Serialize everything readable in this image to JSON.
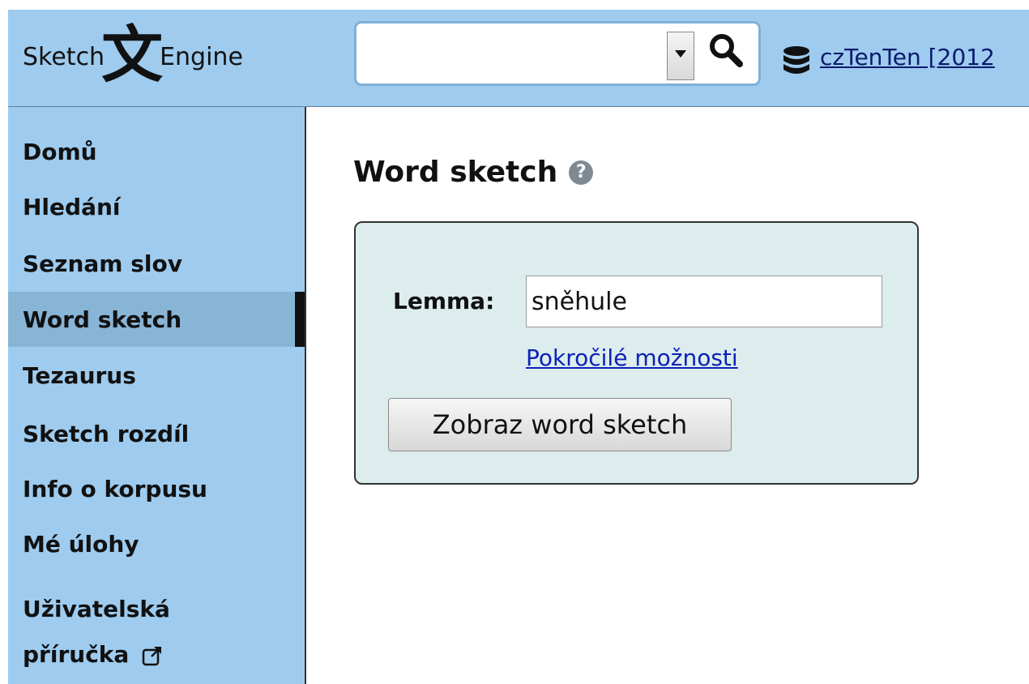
{
  "header": {
    "logo_left": "Sketch",
    "logo_glyph": "文",
    "logo_right": "Engine",
    "search": {
      "value": "",
      "placeholder": ""
    },
    "corpus_link": "czTenTen [2012"
  },
  "sidebar": {
    "items": [
      {
        "label": "Domů"
      },
      {
        "label": "Hledání"
      },
      {
        "label": "Seznam slov"
      },
      {
        "label": "Word sketch",
        "active": true
      },
      {
        "label": "Tezaurus"
      },
      {
        "label": "Sketch rozdíl"
      },
      {
        "label": "Info o korpusu"
      },
      {
        "label": "Mé úlohy"
      }
    ],
    "manual": {
      "line1": "Uživatelská",
      "line2": "příručka"
    }
  },
  "main": {
    "title": "Word sketch",
    "help_glyph": "?",
    "form": {
      "lemma_label": "Lemma:",
      "lemma_value": "sněhule",
      "advanced_link": "Pokročilé možnosti",
      "submit_label": "Zobraz word sketch"
    }
  },
  "colors": {
    "header_bg": "#9ecbee",
    "sidebar_bg": "#9ecbee",
    "active_item_bg": "#88b4d6",
    "panel_bg": "#ddeced",
    "link": "#0b22b8"
  },
  "icons": [
    "search-icon",
    "database-icon",
    "help-icon",
    "external-link-icon",
    "dropdown-arrow-icon"
  ]
}
